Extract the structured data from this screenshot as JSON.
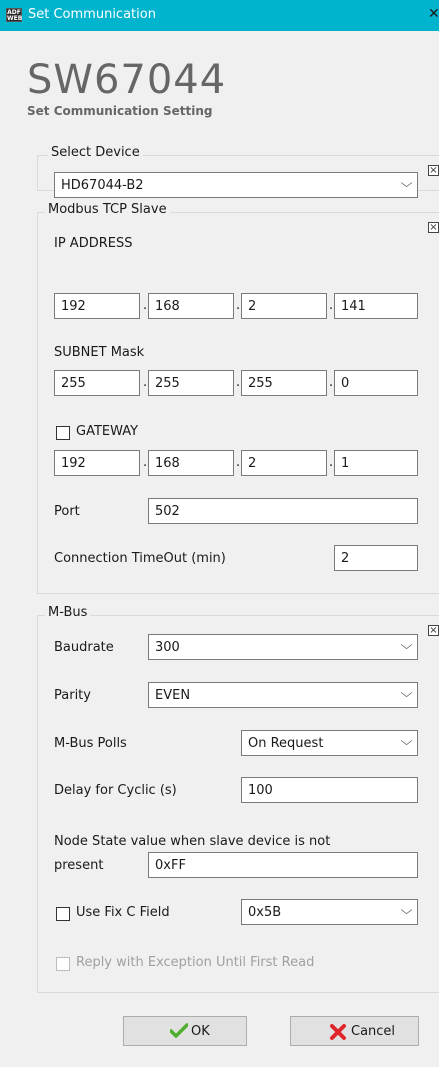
{
  "window": {
    "title": "Set Communication",
    "close_glyph": "✕",
    "app_icon_label": "ADF WEB"
  },
  "header": {
    "product": "SW67044",
    "subtitle": "Set Communication Setting"
  },
  "select_device": {
    "legend": "Select Device",
    "value": "HD67044-B2"
  },
  "modbus": {
    "legend": "Modbus TCP Slave",
    "ip_label": "IP ADDRESS",
    "ip": [
      "192",
      "168",
      "2",
      "141"
    ],
    "subnet_label": "SUBNET Mask",
    "subnet": [
      "255",
      "255",
      "255",
      "0"
    ],
    "gateway_label": "GATEWAY",
    "gateway_checked": false,
    "gateway": [
      "192",
      "168",
      "2",
      "1"
    ],
    "port_label": "Port",
    "port": "502",
    "timeout_label": "Connection TimeOut (min)",
    "timeout": "2"
  },
  "mbus": {
    "legend": "M-Bus",
    "baudrate_label": "Baudrate",
    "baudrate": "300",
    "parity_label": "Parity",
    "parity": "EVEN",
    "polls_label": "M-Bus Polls",
    "polls": "On Request",
    "delay_label": "Delay for Cyclic (s)",
    "delay": "100",
    "node_state_label_1": "Node State value when slave device is not",
    "node_state_label_2": "present",
    "node_state": "0xFF",
    "fixc_label": "Use Fix C Field",
    "fixc_checked": false,
    "fixc": "0x5B",
    "reply_label": "Reply with Exception Until First Read",
    "reply_checked": false
  },
  "buttons": {
    "ok": "OK",
    "cancel": "Cancel"
  },
  "colors": {
    "titlebar": "#00b4ce",
    "ok_icon": "#4fae2e",
    "cancel_icon": "#e0262a"
  },
  "icons": {
    "collapse": "x-box-icon",
    "dropdown": "chevron-down-icon",
    "ok": "checkmark-icon",
    "cancel": "cross-icon"
  }
}
